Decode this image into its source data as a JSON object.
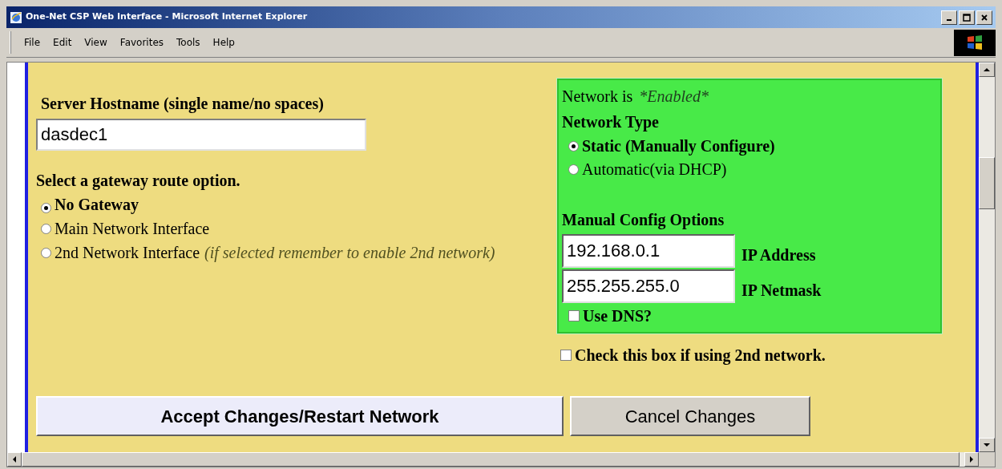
{
  "window": {
    "title": "One-Net CSP Web Interface - Microsoft Internet Explorer"
  },
  "menu": [
    "File",
    "Edit",
    "View",
    "Favorites",
    "Tools",
    "Help"
  ],
  "hostname": {
    "label": "Server Hostname (single name/no spaces)",
    "value": "dasdec1"
  },
  "gateway": {
    "label": "Select a gateway route option.",
    "options": [
      {
        "label": "No Gateway",
        "selected": true
      },
      {
        "label": "Main Network Interface",
        "selected": false
      },
      {
        "label": "2nd Network Interface",
        "note": "(if selected remember to enable 2nd network)",
        "selected": false
      }
    ]
  },
  "network": {
    "status_label": "Network is",
    "status": "*Enabled*",
    "type_label": "Network Type",
    "types": [
      {
        "label": "Static (Manually Configure)",
        "selected": true
      },
      {
        "label": "Automatic(via DHCP)",
        "selected": false
      }
    ],
    "manual_label": "Manual Config Options",
    "fields": [
      {
        "label": "IP Address",
        "value": "192.168.0.1"
      },
      {
        "label": "IP Netmask",
        "value": "255.255.255.0"
      }
    ],
    "dns": {
      "label": "Use DNS?",
      "checked": false
    }
  },
  "second_network": {
    "label": "Check this box if using 2nd network.",
    "checked": false
  },
  "buttons": [
    {
      "label": "Accept Changes/Restart Network",
      "kind": "primary"
    },
    {
      "label": "Cancel Changes",
      "kind": "secondary"
    }
  ]
}
